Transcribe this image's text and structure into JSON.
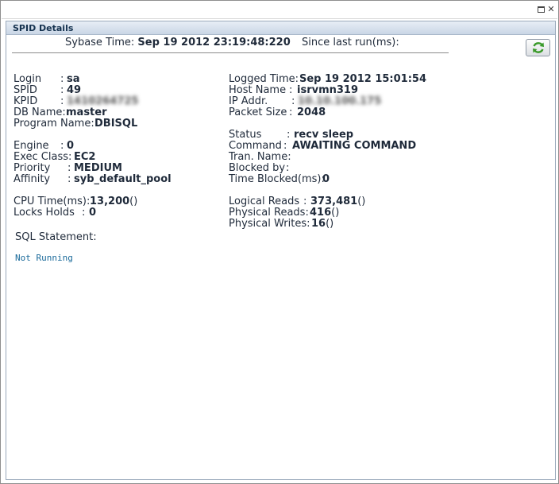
{
  "panel": {
    "title": "SPID Details"
  },
  "header": {
    "sybase_time_label": "Sybase Time:",
    "sybase_time_value": "Sep 19 2012 23:19:48:220",
    "since_last_run_label": "Since last run(ms):"
  },
  "left": [
    {
      "label": "Login",
      "sep": ":",
      "value": "sa",
      "suffix": ""
    },
    {
      "label": "SPID",
      "sep": ":",
      "value": "49",
      "suffix": ""
    },
    {
      "label": "KPID",
      "sep": ":",
      "value": "1410264725",
      "suffix": ""
    },
    {
      "label": "DB Name:",
      "sep": "",
      "value": "master",
      "suffix": ""
    },
    {
      "label": "Program Name:",
      "sep": "",
      "value": "DBISQL",
      "suffix": ""
    },
    {
      "label": "Engine",
      "sep": ":",
      "value": "0",
      "suffix": ""
    },
    {
      "label": "Exec Class:",
      "sep": "",
      "value": "EC2",
      "suffix": ""
    },
    {
      "label": "Priority",
      "sep": ":",
      "value": "MEDIUM",
      "suffix": ""
    },
    {
      "label": "Affinity",
      "sep": ":",
      "value": "syb_default_pool",
      "suffix": ""
    },
    {
      "label": "CPU Time(ms):",
      "sep": "",
      "value": "13,200",
      "suffix": "()"
    },
    {
      "label": "Locks Holds",
      "sep": ":",
      "value": "0",
      "suffix": ""
    }
  ],
  "right": [
    {
      "label": "Logged Time:",
      "sep": "",
      "value": "Sep 19 2012 15:01:54",
      "suffix": ""
    },
    {
      "label": "Host Name",
      "sep": ":",
      "value": "isrvmn319",
      "suffix": ""
    },
    {
      "label": "IP Addr.",
      "sep": ":",
      "value": "10.10.100.175",
      "suffix": ""
    },
    {
      "label": "Packet Size",
      "sep": ":",
      "value": "2048",
      "suffix": ""
    },
    {
      "label": "Status",
      "sep": ":",
      "value": "recv sleep",
      "suffix": ""
    },
    {
      "label": "Command",
      "sep": ":",
      "value": "AWAITING COMMAND",
      "suffix": ""
    },
    {
      "label": "Tran. Name:",
      "sep": "",
      "value": "",
      "suffix": ""
    },
    {
      "label": "Blocked by",
      "sep": ":",
      "value": "",
      "suffix": ""
    },
    {
      "label": "Time Blocked(ms):",
      "sep": "",
      "value": "0",
      "suffix": ""
    },
    {
      "label": "Logical Reads",
      "sep": ":",
      "value": "373,481",
      "suffix": "()"
    },
    {
      "label": "Physical Reads:",
      "sep": "",
      "value": "416",
      "suffix": "()"
    },
    {
      "label": "Physical Writes:",
      "sep": "",
      "value": "16",
      "suffix": "()"
    }
  ],
  "sql": {
    "label": "SQL Statement:",
    "text": "Not Running"
  },
  "icons": {
    "refresh": "refresh-icon",
    "maximize": "maximize-icon",
    "close": "close-icon"
  },
  "colors": {
    "header_bg": "#c9d6e6",
    "sql_text": "#1a6a9a",
    "refresh_green": "#3a9a2a"
  }
}
